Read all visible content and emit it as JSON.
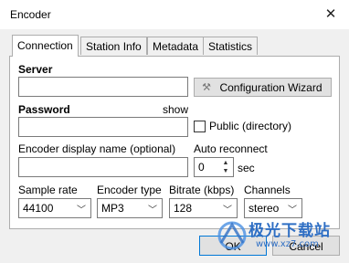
{
  "window": {
    "title": "Encoder"
  },
  "tabs": [
    {
      "label": "Connection",
      "active": true
    },
    {
      "label": "Station Info",
      "active": false
    },
    {
      "label": "Metadata",
      "active": false
    },
    {
      "label": "Statistics",
      "active": false
    }
  ],
  "server": {
    "label": "Server",
    "value": ""
  },
  "config_wizard": {
    "label": "Configuration Wizard",
    "icon": "wand-icon"
  },
  "password": {
    "label": "Password",
    "show_label": "show",
    "value": ""
  },
  "public_directory": {
    "label": "Public (directory)",
    "checked": false
  },
  "display_name": {
    "label": "Encoder display name (optional)",
    "value": ""
  },
  "auto_reconnect": {
    "label": "Auto reconnect",
    "value": "0",
    "unit": "sec"
  },
  "sample_rate": {
    "label": "Sample rate",
    "value": "44100"
  },
  "encoder_type": {
    "label": "Encoder type",
    "value": "MP3"
  },
  "bitrate": {
    "label": "Bitrate (kbps)",
    "value": "128"
  },
  "channels": {
    "label": "Channels",
    "value": "stereo"
  },
  "buttons": {
    "ok": "OK",
    "cancel": "Cancel"
  },
  "watermark": {
    "main": "极光下载站",
    "sub": "www.xz7.com"
  },
  "colors": {
    "accent": "#0078d7",
    "watermark": "#2f6fc4"
  }
}
